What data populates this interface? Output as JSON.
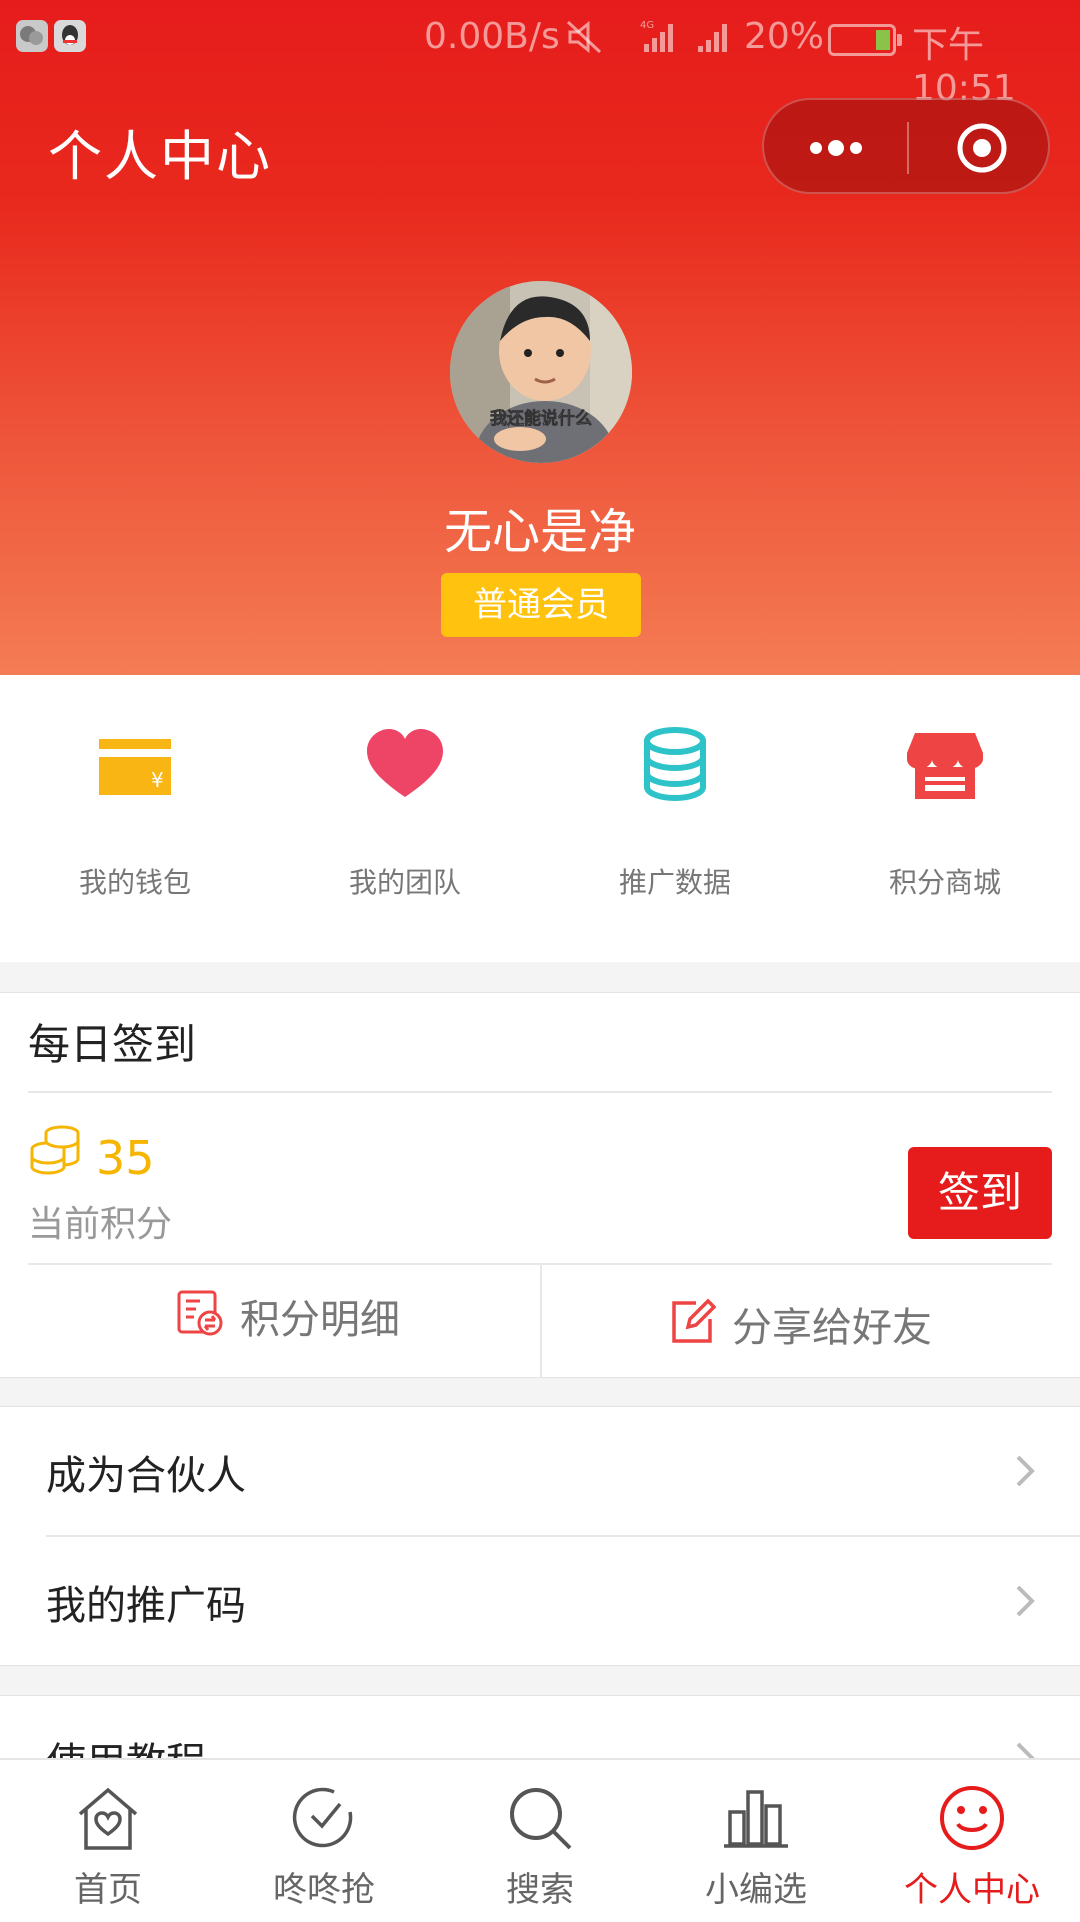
{
  "status_bar": {
    "network_speed": "0.00B/s",
    "network_type": "4G",
    "battery": "20%",
    "time": "下午10:51",
    "notification_icons": [
      "wechat-icon",
      "qq-icon"
    ]
  },
  "header": {
    "title": "个人中心",
    "capsule": {
      "more_icon": "more-dots-icon",
      "close_icon": "target-circle-icon"
    }
  },
  "profile": {
    "avatar_caption": "我还能说什么",
    "username": "无心是净",
    "member_level": "普通会员"
  },
  "quick_menu": [
    {
      "label": "我的钱包",
      "icon": "wallet-icon",
      "color": "#f9b514"
    },
    {
      "label": "我的团队",
      "icon": "heart-icon",
      "color": "#ee4466"
    },
    {
      "label": "推广数据",
      "icon": "database-icon",
      "color": "#2ec3c8"
    },
    {
      "label": "积分商城",
      "icon": "store-icon",
      "color": "#ee4444"
    }
  ],
  "daily_checkin": {
    "title": "每日签到",
    "points": "35",
    "points_label": "当前积分",
    "sign_button": "签到",
    "actions": [
      {
        "label": "积分明细",
        "icon": "points-detail-icon"
      },
      {
        "label": "分享给好友",
        "icon": "share-edit-icon"
      }
    ]
  },
  "menu_list": [
    {
      "label": "成为合伙人"
    },
    {
      "label": "我的推广码"
    },
    {
      "label": "使用教程"
    }
  ],
  "tab_bar": {
    "active": "个人中心",
    "tabs": [
      {
        "label": "首页",
        "icon": "home-heart-icon"
      },
      {
        "label": "咚咚抢",
        "icon": "check-clock-icon"
      },
      {
        "label": "搜索",
        "icon": "search-icon"
      },
      {
        "label": "小编选",
        "icon": "chart-bars-icon"
      },
      {
        "label": "个人中心",
        "icon": "smiley-icon"
      }
    ]
  },
  "colors": {
    "brand_red": "#e61c1c",
    "gold": "#ffc20e",
    "points_gold": "#f5b500"
  }
}
